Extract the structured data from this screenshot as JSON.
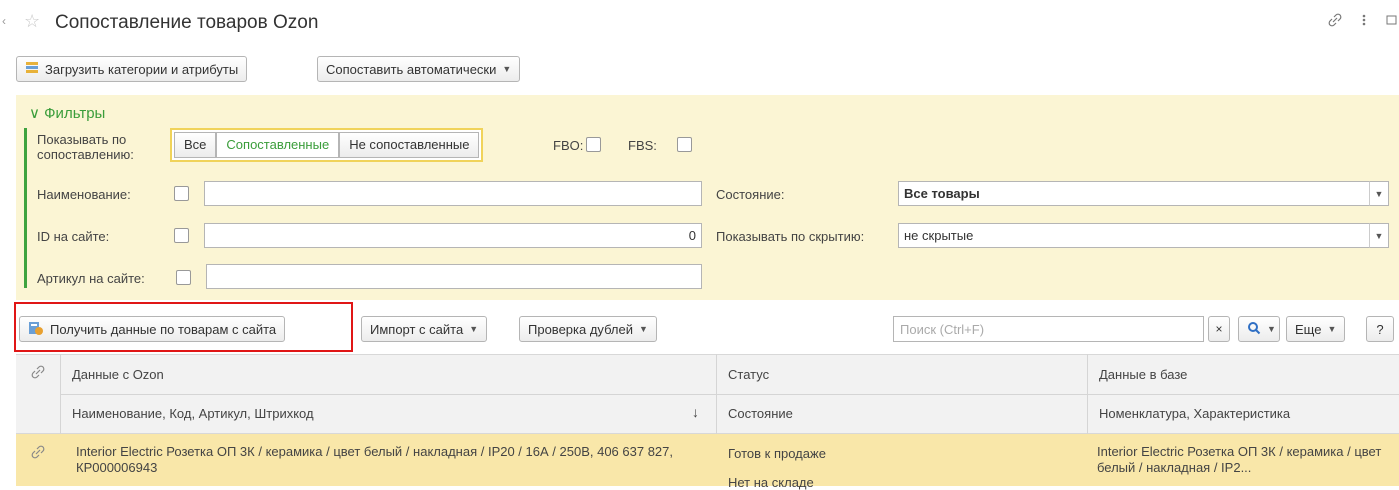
{
  "window": {
    "title": "Сопоставление товаров Ozon",
    "nav_arrow": "‹",
    "star": "☆",
    "icons": [
      "link-icon",
      "more-icon",
      "maximize-icon"
    ]
  },
  "toolbar": {
    "load_label": "Загрузить категории и атрибуты",
    "auto_match_label": "Сопоставить автоматически"
  },
  "filters": {
    "header": "Фильтры",
    "show_by_match_label": "Показывать по сопоставлению:",
    "segments": [
      "Все",
      "Сопоставленные",
      "Не сопоставленные"
    ],
    "active_segment": "Сопоставленные",
    "fbo_label": "FBO:",
    "fbs_label": "FBS:",
    "name_label": "Наименование:",
    "name_value": "",
    "site_id_label": "ID на сайте:",
    "site_id_value": "0",
    "sku_label": "Артикул на сайте:",
    "sku_value": "",
    "state_label": "Состояние:",
    "state_value": "Все товары",
    "hidden_label": "Показывать по скрытию:",
    "hidden_value": "не скрытые"
  },
  "commands": {
    "get_data_label": "Получить данные по товарам с сайта",
    "import_label": "Импорт с сайта",
    "duplicates_label": "Проверка дублей",
    "search_placeholder": "Поиск (Ctrl+F)",
    "clear_label": "×",
    "more_label": "Еще",
    "help_label": "?"
  },
  "table": {
    "columns": {
      "ozon": "Данные с Ozon",
      "ozon_sub": "Наименование, Код, Артикул, Штрихкод",
      "status": "Статус",
      "status_sub": "Состояние",
      "db": "Данные в базе",
      "db_sub": "Номенклатура, Характеристика"
    },
    "sort_arrow": "↓",
    "rows": [
      {
        "ozon": "Interior Electric Розетка ОП 3К / керамика / цвет белый / накладная / IP20 / 16А / 250В, 406 637 827, КР000006943",
        "status": "Готов к продаже",
        "state": "Нет на складе",
        "db": "Interior Electric Розетка ОП 3К / керамика / цвет белый / накладная / IP2..."
      }
    ]
  },
  "colors": {
    "accent_green": "#3a9d3a",
    "filter_bg": "#fbf5d4",
    "selected_row": "#f9e7a9",
    "highlight_red": "#e01616"
  }
}
